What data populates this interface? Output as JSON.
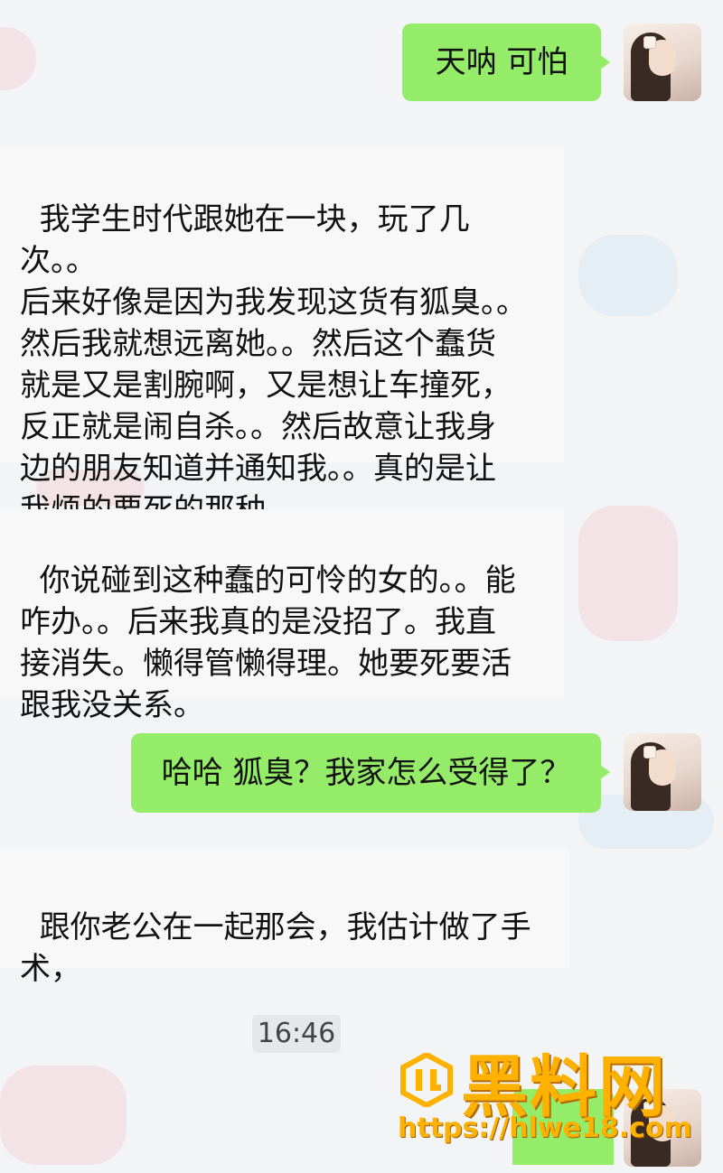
{
  "chat": {
    "msg1": {
      "text": "天呐 可怕"
    },
    "msg2": {
      "text": "我学生时代跟她在一块，玩了几次。。\n后来好像是因为我发现这货有狐臭。。\n然后我就想远离她。。然后这个蠢货\n就是又是割腕啊，又是想让车撞死，\n反正就是闹自杀。。然后故意让我身\n边的朋友知道并通知我。。真的是让\n我烦的要死的那种。"
    },
    "msg3": {
      "text": "你说碰到这种蠢的可怜的女的。。能\n咋办。。后来我真的是没招了。我直\n接消失。懒得管懒得理。她要死要活\n跟我没关系。"
    },
    "msg4": {
      "text": "哈哈 狐臭？我家怎么受得了？"
    },
    "msg5": {
      "text": "跟你老公在一起那会，我估计做了手\n术，"
    },
    "timestamp": "16:46"
  },
  "watermark": {
    "name": "黑料网",
    "url": "https://hlwe18.com"
  },
  "colors": {
    "bubble_out": "#95ec69",
    "panel_in": "#f8f8f8",
    "watermark": "#ffb100"
  }
}
